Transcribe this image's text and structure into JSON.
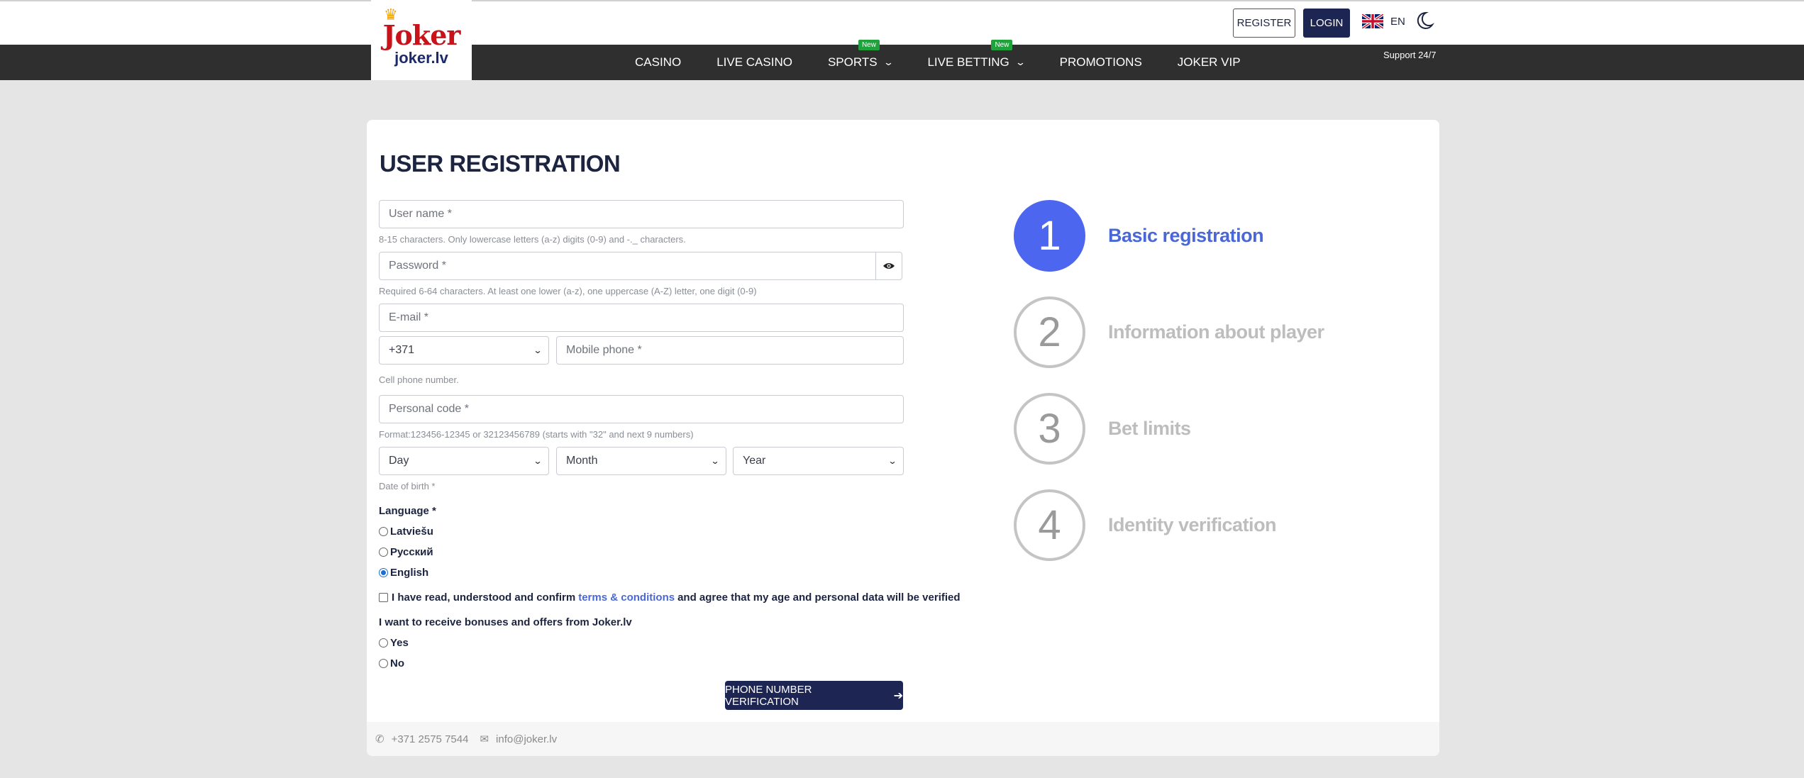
{
  "header": {
    "logo_brand": "Joker",
    "logo_site": "joker.lv",
    "register_label": "REGISTER",
    "login_label": "LOGIN",
    "language_code": "EN",
    "support_label": "Support 24/7"
  },
  "nav": {
    "items": [
      {
        "label": "CASINO"
      },
      {
        "label": "LIVE CASINO"
      },
      {
        "label": "SPORTS",
        "badge": "New"
      },
      {
        "label": "LIVE BETTING",
        "badge": "New"
      },
      {
        "label": "PROMOTIONS"
      },
      {
        "label": "JOKER VIP"
      }
    ]
  },
  "form": {
    "title": "USER REGISTRATION",
    "username_placeholder": "User name *",
    "username_hint": "8-15 characters. Only lowercase letters (a-z) digits (0-9) and -._ characters.",
    "password_placeholder": "Password *",
    "password_hint": "Required 6-64 characters. At least one lower (a-z), one uppercase (A-Z) letter, one digit (0-9)",
    "email_placeholder": "E-mail *",
    "phone_code": "+371",
    "mobile_placeholder": "Mobile phone *",
    "phone_hint": "Cell phone number.",
    "personal_code_placeholder": "Personal code *",
    "personal_code_hint": "Format:123456-12345 or 32123456789 (starts with \"32\" and next 9 numbers)",
    "dob_day": "Day",
    "dob_month": "Month",
    "dob_year": "Year",
    "dob_hint": "Date of birth *",
    "language_label": "Language *",
    "languages": [
      {
        "label": "Latviešu",
        "checked": false
      },
      {
        "label": "Русский",
        "checked": false
      },
      {
        "label": "English",
        "checked": true
      }
    ],
    "terms_before": "I have read, understood and confirm",
    "terms_link": "terms & conditions",
    "terms_after": "and agree that my age and personal data will be verified",
    "bonus_label": "I want to receive bonuses and offers from Joker.lv",
    "bonus_options": [
      {
        "label": "Yes",
        "checked": false
      },
      {
        "label": "No",
        "checked": false
      }
    ],
    "submit_label": "PHONE NUMBER VERIFICATION"
  },
  "steps": [
    {
      "number": "1",
      "title": "Basic registration",
      "active": true
    },
    {
      "number": "2",
      "title": "Information about player",
      "active": false
    },
    {
      "number": "3",
      "title": "Bet limits",
      "active": false
    },
    {
      "number": "4",
      "title": "Identity verification",
      "active": false
    }
  ],
  "footer": {
    "phone": "+371 2575 7544",
    "email": "info@joker.lv"
  },
  "colors": {
    "accent": "#1d2552",
    "step_active": "#4d66f0",
    "link": "#4a67d6",
    "badge_new": "#1fa23c",
    "brand_red": "#c8131a"
  }
}
